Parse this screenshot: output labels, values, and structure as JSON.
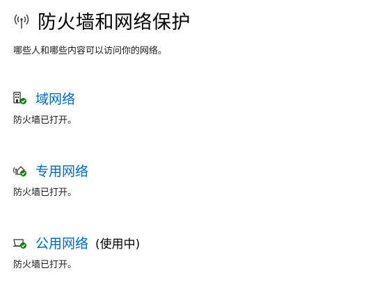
{
  "header": {
    "icon": "wifi-antenna-icon",
    "title": "防火墙和网络保护",
    "subtitle": "哪些人和哪些内容可以访问你的网络。"
  },
  "networks": [
    {
      "icon": "domain-network-icon",
      "label": "域网络",
      "in_use": "",
      "status": "防火墙已打开。"
    },
    {
      "icon": "private-network-icon",
      "label": "专用网络",
      "in_use": "",
      "status": "防火墙已打开。"
    },
    {
      "icon": "public-network-icon",
      "label": "公用网络",
      "in_use": "(使用中)",
      "status": "防火墙已打开。"
    }
  ],
  "colors": {
    "link": "#0067b8",
    "check_badge": "#107c10"
  }
}
